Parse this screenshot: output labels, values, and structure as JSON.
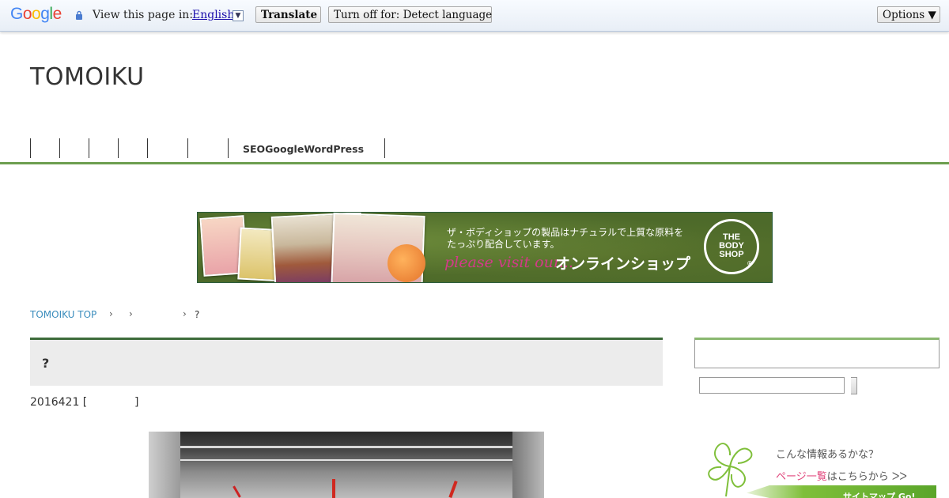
{
  "translate_bar": {
    "logo": {
      "letters": [
        "G",
        "o",
        "o",
        "g",
        "l",
        "e"
      ]
    },
    "view_text": "View this page in:",
    "language": "English",
    "translate_label": "Translate",
    "turn_off_label": "Turn off for: Detect language",
    "options_label": "Options ▼"
  },
  "site": {
    "title": "TOMOIKU",
    "nav_text": "SEOGoogleWordPress",
    "accent_color": "#6d9e4f"
  },
  "banner": {
    "jp_line1": "ザ・ボディショップの製品はナチュラルで上質な原料を",
    "jp_line2": "たっぷり配合しています。",
    "script": "please visit our...",
    "online": "オンラインショップ",
    "logo_line1": "THE",
    "logo_line2": "BODY",
    "logo_line3": "SHOP",
    "logo_mark": "®"
  },
  "breadcrumb": {
    "home": "TOMOIKU TOP",
    "arrow": "›",
    "current": "?"
  },
  "post": {
    "title": "?",
    "date": "2016421 [",
    "category_close": "]"
  },
  "sidebar": {
    "question": "こんな情報あるかな？",
    "link_highlight": "ページ一覧",
    "link_rest": "はこちらから ᐳᐳ",
    "pencil_text": "サイトマップ Go!"
  }
}
